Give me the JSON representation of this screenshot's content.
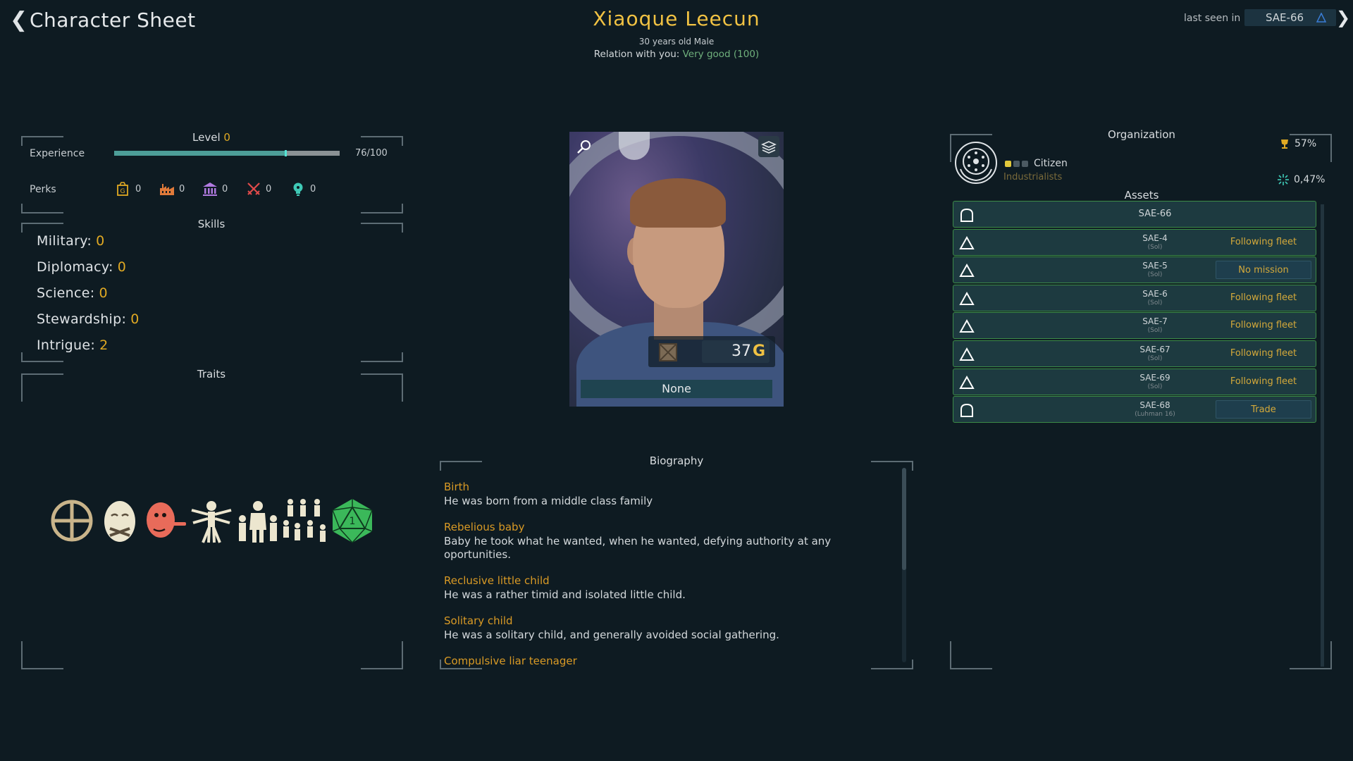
{
  "header": {
    "back_glyph": "❮",
    "title": "Character Sheet",
    "name": "Xiaoque Leecun",
    "subline": "30 years old  Male",
    "relation_label": "Relation with you:",
    "relation_value": "Very good (100)",
    "last_seen_label": "last seen in",
    "last_seen_value": "SAE-66",
    "next_glyph": "❯"
  },
  "experience": {
    "level_label": "Level",
    "level_value": "0",
    "label": "Experience",
    "value_text": "76/100",
    "progress": 0.76
  },
  "perks": {
    "label": "Perks",
    "items": [
      {
        "icon": "gold-bag-icon",
        "value": "0",
        "color": "#e0a923"
      },
      {
        "icon": "factory-icon",
        "value": "0",
        "color": "#e07a3a"
      },
      {
        "icon": "government-building-icon",
        "value": "0",
        "color": "#b07ae0"
      },
      {
        "icon": "crossed-swords-icon",
        "value": "0",
        "color": "#e04a4a"
      },
      {
        "icon": "lightbulb-icon",
        "value": "0",
        "color": "#3fc9b6"
      }
    ]
  },
  "skills": {
    "title": "Skills",
    "items": [
      {
        "label": "Military:",
        "value": "0"
      },
      {
        "label": "Diplomacy:",
        "value": "0"
      },
      {
        "label": "Science:",
        "value": "0"
      },
      {
        "label": "Stewardship:",
        "value": "0"
      },
      {
        "label": "Intrigue:",
        "value": "2"
      }
    ]
  },
  "traits": {
    "title": "Traits",
    "icons": [
      "crosshair-icon",
      "masked-face-icon",
      "liar-face-icon",
      "vitruvian-man-icon",
      "family-icon",
      "crowd-icon",
      "d20-dice-icon"
    ]
  },
  "portrait": {
    "credits": "37",
    "currency_glyph": "G",
    "cargo_label": "None"
  },
  "biography": {
    "title": "Biography",
    "entries": [
      {
        "head": "Birth",
        "text": "He was born from a middle class family"
      },
      {
        "head": "Rebelious baby",
        "text": "Baby he took what he wanted, when he wanted, defying authority at any oportunities."
      },
      {
        "head": "Reclusive little child",
        "text": "He was a rather timid and isolated little child."
      },
      {
        "head": "Solitary child",
        "text": "He was a solitary child, and generally avoided social gathering."
      },
      {
        "head": "Compulsive liar teenager",
        "text": ""
      }
    ]
  },
  "organization": {
    "title": "Organization",
    "rank": "Citizen",
    "faction": "Industrialists",
    "rank_pips_on": 1,
    "rank_pips_total": 3,
    "stat1": "57%",
    "stat2": "0,47%"
  },
  "assets": {
    "title": "Assets",
    "items": [
      {
        "icon": "station-icon",
        "name": "SAE-66",
        "loc": "",
        "status": "",
        "status_button": false
      },
      {
        "icon": "ship-icon",
        "name": "SAE-4",
        "loc": "(Sol)",
        "status": "Following fleet",
        "status_button": false
      },
      {
        "icon": "ship-icon",
        "name": "SAE-5",
        "loc": "(Sol)",
        "status": "No mission",
        "status_button": true
      },
      {
        "icon": "ship-icon",
        "name": "SAE-6",
        "loc": "(Sol)",
        "status": "Following fleet",
        "status_button": false
      },
      {
        "icon": "ship-icon",
        "name": "SAE-7",
        "loc": "(Sol)",
        "status": "Following fleet",
        "status_button": false
      },
      {
        "icon": "ship-icon",
        "name": "SAE-67",
        "loc": "(Sol)",
        "status": "Following fleet",
        "status_button": false
      },
      {
        "icon": "ship-icon",
        "name": "SAE-69",
        "loc": "(Sol)",
        "status": "Following fleet",
        "status_button": false
      },
      {
        "icon": "station-icon",
        "name": "SAE-68",
        "loc": "(Luhman 16)",
        "status": "Trade",
        "status_button": true
      }
    ]
  }
}
